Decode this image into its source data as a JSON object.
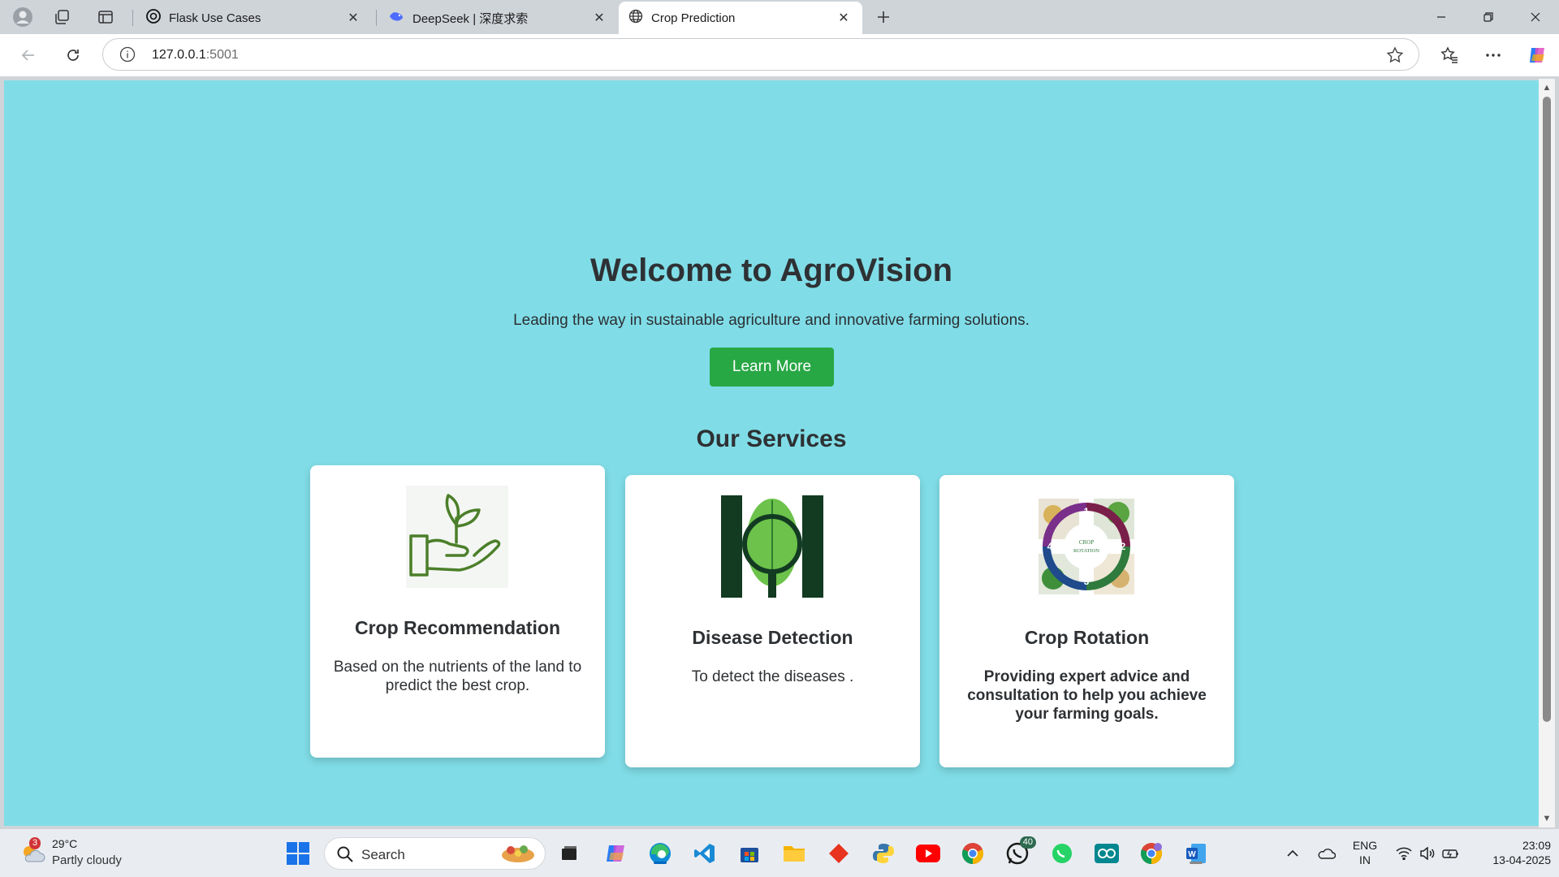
{
  "browser": {
    "tabs": [
      {
        "title": "Flask Use Cases",
        "icon": "openai-icon"
      },
      {
        "title": "DeepSeek | 深度求索",
        "icon": "deepseek-icon"
      },
      {
        "title": "Crop Prediction",
        "icon": "globe-icon",
        "active": true
      }
    ],
    "url_host": "127.0.0.1",
    "url_port": ":5001"
  },
  "page": {
    "hero_title": "Welcome to AgroVision",
    "hero_subtitle": "Leading the way in sustainable agriculture and innovative farming solutions.",
    "learn_more": "Learn More",
    "services_title": "Our Services",
    "cards": [
      {
        "title": "Crop Recommendation",
        "text": "Based on the nutrients of the land to predict the best crop.",
        "icon": "hand-plant-icon"
      },
      {
        "title": "Disease Detection",
        "text": "To detect the diseases .",
        "icon": "leaf-magnifier-icon"
      },
      {
        "title": "Crop Rotation",
        "text": "Providing expert advice and consultation to help you achieve your farming goals.",
        "icon": "crop-rotation-diagram",
        "diagram_label": "CROP ROTATION",
        "steps": [
          "1",
          "2",
          "3",
          "4"
        ]
      }
    ],
    "colors": {
      "background": "#80dde7",
      "button": "#28a745",
      "text": "#2e3134"
    }
  },
  "taskbar": {
    "weather_badge": "3",
    "temperature": "29°C",
    "condition": "Partly cloudy",
    "search_placeholder": "Search",
    "whatsapp_badge": "40",
    "lang_top": "ENG",
    "lang_bottom": "IN",
    "time": "23:09",
    "date": "13-04-2025"
  }
}
